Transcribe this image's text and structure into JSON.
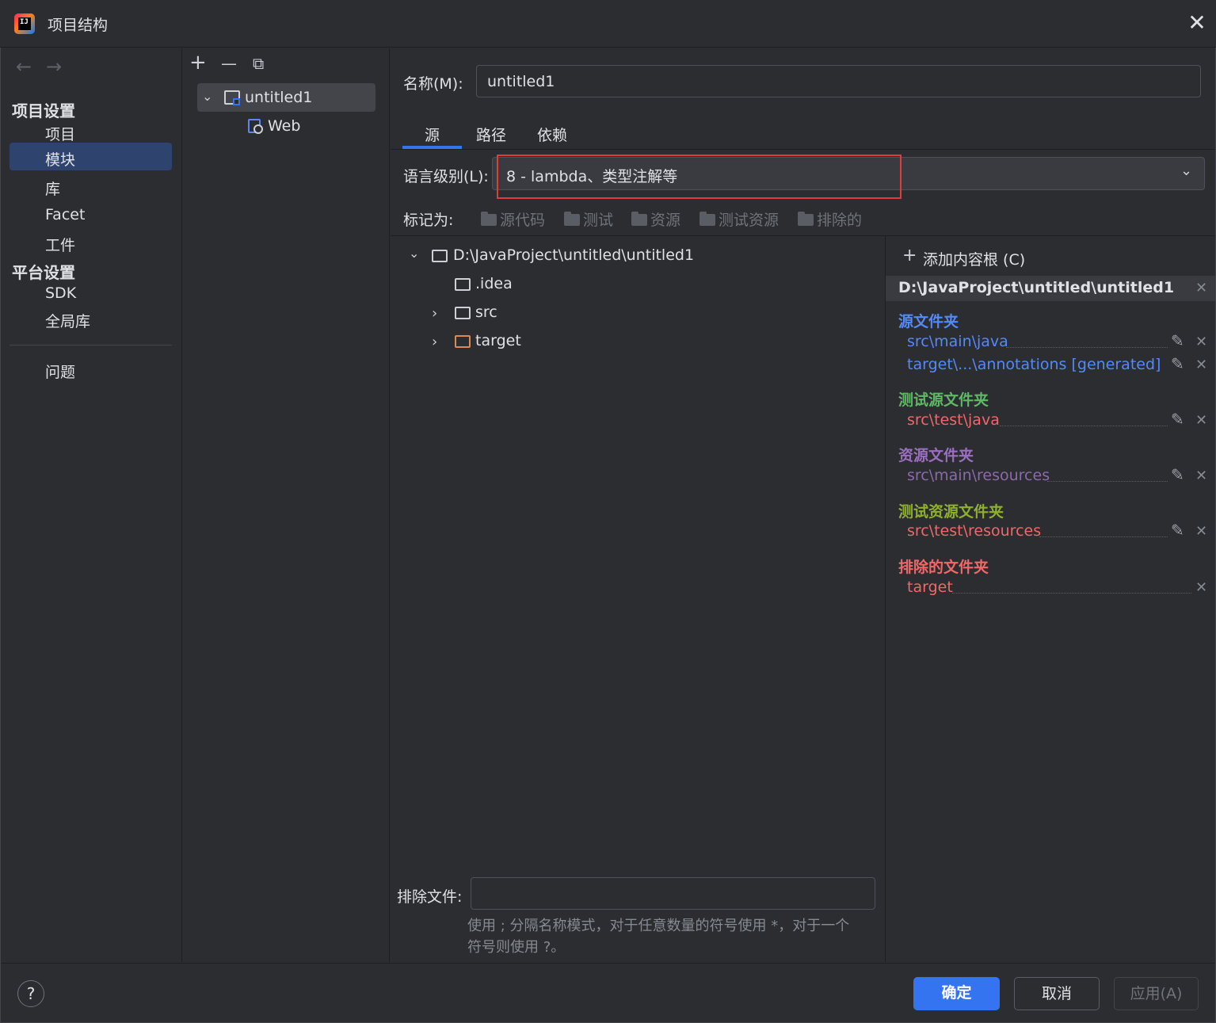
{
  "window": {
    "title": "项目结构",
    "close_glyph": "✕"
  },
  "nav": {
    "back": "←",
    "forward": "→",
    "project_settings_header": "项目设置",
    "project_items": [
      "项目",
      "模块",
      "库",
      "Facet",
      "工件"
    ],
    "selected_item": "模块",
    "platform_settings_header": "平台设置",
    "platform_items": [
      "SDK",
      "全局库"
    ],
    "problems": "问题"
  },
  "modules": {
    "toolbar": {
      "add": "+",
      "remove": "—",
      "copy": "⧉"
    },
    "tree": [
      {
        "label": "untitled1",
        "expanded": true,
        "selected": true
      },
      {
        "label": "Web"
      }
    ]
  },
  "main": {
    "name_label": "名称(M):",
    "name_value": "untitled1",
    "tabs": [
      "源",
      "路径",
      "依赖"
    ],
    "active_tab": "源",
    "language_level_label": "语言级别(L):",
    "language_level_value": "8 - lambda、类型注解等",
    "mark_as_label": "标记为:",
    "mark_as": [
      "源代码",
      "测试",
      "资源",
      "测试资源",
      "排除的"
    ],
    "file_tree": {
      "root": "D:\\JavaProject\\untitled\\untitled1",
      "children": [
        ".idea",
        "src",
        "target"
      ]
    },
    "exclude_files_label": "排除文件:",
    "exclude_files_value": "",
    "exclude_hint_line1": "使用 ; 分隔名称模式，对于任意数量的符号使用 *，对于一个",
    "exclude_hint_line2": "符号则使用 ?。"
  },
  "content_roots": {
    "add_label": "添加内容根 (C)",
    "add_glyph": "+",
    "path": "D:\\JavaProject\\untitled\\untitled1",
    "sections": [
      {
        "title": "源文件夹",
        "color": "#548af7",
        "entries": [
          "src\\main\\java",
          "target\\...\\annotations [generated]"
        ]
      },
      {
        "title": "测试源文件夹",
        "color": "#5fb865",
        "entries": [
          "src\\test\\java"
        ]
      },
      {
        "title": "资源文件夹",
        "color": "#9b6ec2",
        "entries": [
          "src\\main\\resources"
        ]
      },
      {
        "title": "测试资源文件夹",
        "color": "#8fb02e",
        "entries": [
          "src\\test\\resources"
        ]
      },
      {
        "title": "排除的文件夹",
        "color": "#f06868",
        "entries": [
          "target"
        ]
      }
    ],
    "entry_colors": {
      "source": "#548af7",
      "test": "#f06868",
      "resource": "#8c6aa8",
      "test_resource": "#f06868",
      "excluded": "#f06868"
    }
  },
  "footer": {
    "help": "?",
    "ok": "确定",
    "cancel": "取消",
    "apply": "应用(A)"
  },
  "colors": {
    "accent": "#3574f0",
    "selection": "#2e436e",
    "highlight_box": "#e03c3c",
    "background": "#2b2d30"
  }
}
